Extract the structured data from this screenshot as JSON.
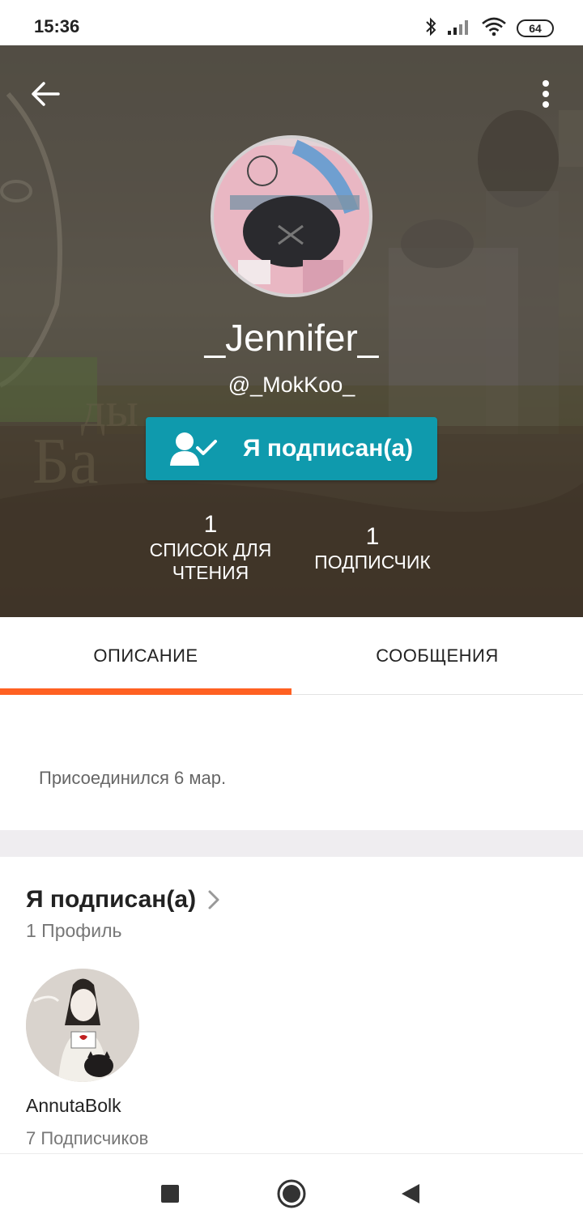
{
  "status_bar": {
    "time": "15:36",
    "battery": "64",
    "icons": [
      "bluetooth-icon",
      "signal-icon",
      "wifi-icon",
      "battery-icon"
    ]
  },
  "profile": {
    "display_name": "_Jennifer_",
    "handle": "@_MokKoo_",
    "follow_button_label": "Я подписан(а)",
    "stats": {
      "reading_lists_count": "1",
      "reading_lists_label": "СПИСОК ДЛЯ ЧТЕНИЯ",
      "followers_count": "1",
      "followers_label": "ПОДПИСЧИК"
    }
  },
  "tabs": [
    {
      "label": "ОПИСАНИЕ",
      "active": true
    },
    {
      "label": "СООБЩЕНИЯ",
      "active": false
    }
  ],
  "about": {
    "joined": "Присоединился 6 мар."
  },
  "following": {
    "title": "Я подписан(а)",
    "count_label": "1 Профиль",
    "profiles": [
      {
        "name": "AnnutaBolk",
        "followers": "7 Подписчиков"
      }
    ]
  },
  "colors": {
    "accent_orange": "#ff6122",
    "follow_teal": "#0f9aad"
  }
}
